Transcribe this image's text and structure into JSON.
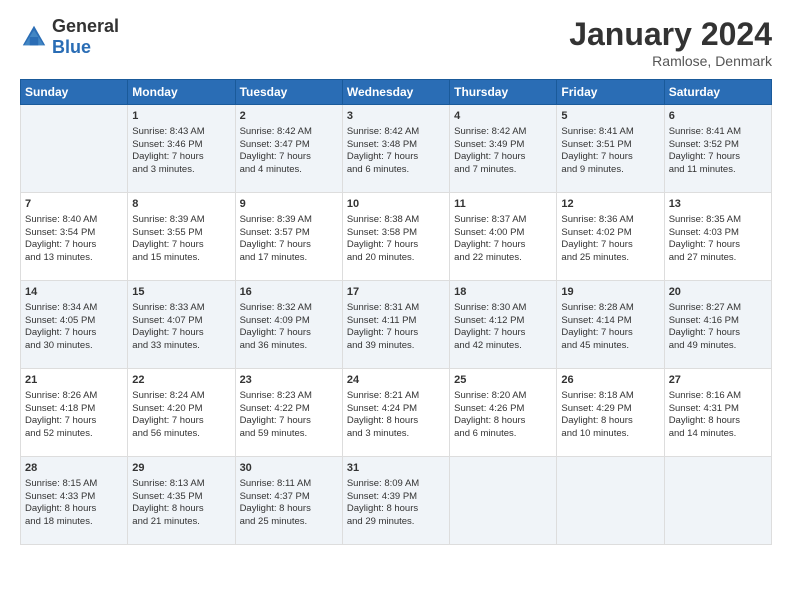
{
  "logo": {
    "general": "General",
    "blue": "Blue"
  },
  "header": {
    "month": "January 2024",
    "location": "Ramlose, Denmark"
  },
  "weekdays": [
    "Sunday",
    "Monday",
    "Tuesday",
    "Wednesday",
    "Thursday",
    "Friday",
    "Saturday"
  ],
  "rows": [
    [
      {
        "day": "",
        "lines": []
      },
      {
        "day": "1",
        "lines": [
          "Sunrise: 8:43 AM",
          "Sunset: 3:46 PM",
          "Daylight: 7 hours",
          "and 3 minutes."
        ]
      },
      {
        "day": "2",
        "lines": [
          "Sunrise: 8:42 AM",
          "Sunset: 3:47 PM",
          "Daylight: 7 hours",
          "and 4 minutes."
        ]
      },
      {
        "day": "3",
        "lines": [
          "Sunrise: 8:42 AM",
          "Sunset: 3:48 PM",
          "Daylight: 7 hours",
          "and 6 minutes."
        ]
      },
      {
        "day": "4",
        "lines": [
          "Sunrise: 8:42 AM",
          "Sunset: 3:49 PM",
          "Daylight: 7 hours",
          "and 7 minutes."
        ]
      },
      {
        "day": "5",
        "lines": [
          "Sunrise: 8:41 AM",
          "Sunset: 3:51 PM",
          "Daylight: 7 hours",
          "and 9 minutes."
        ]
      },
      {
        "day": "6",
        "lines": [
          "Sunrise: 8:41 AM",
          "Sunset: 3:52 PM",
          "Daylight: 7 hours",
          "and 11 minutes."
        ]
      }
    ],
    [
      {
        "day": "7",
        "lines": [
          "Sunrise: 8:40 AM",
          "Sunset: 3:54 PM",
          "Daylight: 7 hours",
          "and 13 minutes."
        ]
      },
      {
        "day": "8",
        "lines": [
          "Sunrise: 8:39 AM",
          "Sunset: 3:55 PM",
          "Daylight: 7 hours",
          "and 15 minutes."
        ]
      },
      {
        "day": "9",
        "lines": [
          "Sunrise: 8:39 AM",
          "Sunset: 3:57 PM",
          "Daylight: 7 hours",
          "and 17 minutes."
        ]
      },
      {
        "day": "10",
        "lines": [
          "Sunrise: 8:38 AM",
          "Sunset: 3:58 PM",
          "Daylight: 7 hours",
          "and 20 minutes."
        ]
      },
      {
        "day": "11",
        "lines": [
          "Sunrise: 8:37 AM",
          "Sunset: 4:00 PM",
          "Daylight: 7 hours",
          "and 22 minutes."
        ]
      },
      {
        "day": "12",
        "lines": [
          "Sunrise: 8:36 AM",
          "Sunset: 4:02 PM",
          "Daylight: 7 hours",
          "and 25 minutes."
        ]
      },
      {
        "day": "13",
        "lines": [
          "Sunrise: 8:35 AM",
          "Sunset: 4:03 PM",
          "Daylight: 7 hours",
          "and 27 minutes."
        ]
      }
    ],
    [
      {
        "day": "14",
        "lines": [
          "Sunrise: 8:34 AM",
          "Sunset: 4:05 PM",
          "Daylight: 7 hours",
          "and 30 minutes."
        ]
      },
      {
        "day": "15",
        "lines": [
          "Sunrise: 8:33 AM",
          "Sunset: 4:07 PM",
          "Daylight: 7 hours",
          "and 33 minutes."
        ]
      },
      {
        "day": "16",
        "lines": [
          "Sunrise: 8:32 AM",
          "Sunset: 4:09 PM",
          "Daylight: 7 hours",
          "and 36 minutes."
        ]
      },
      {
        "day": "17",
        "lines": [
          "Sunrise: 8:31 AM",
          "Sunset: 4:11 PM",
          "Daylight: 7 hours",
          "and 39 minutes."
        ]
      },
      {
        "day": "18",
        "lines": [
          "Sunrise: 8:30 AM",
          "Sunset: 4:12 PM",
          "Daylight: 7 hours",
          "and 42 minutes."
        ]
      },
      {
        "day": "19",
        "lines": [
          "Sunrise: 8:28 AM",
          "Sunset: 4:14 PM",
          "Daylight: 7 hours",
          "and 45 minutes."
        ]
      },
      {
        "day": "20",
        "lines": [
          "Sunrise: 8:27 AM",
          "Sunset: 4:16 PM",
          "Daylight: 7 hours",
          "and 49 minutes."
        ]
      }
    ],
    [
      {
        "day": "21",
        "lines": [
          "Sunrise: 8:26 AM",
          "Sunset: 4:18 PM",
          "Daylight: 7 hours",
          "and 52 minutes."
        ]
      },
      {
        "day": "22",
        "lines": [
          "Sunrise: 8:24 AM",
          "Sunset: 4:20 PM",
          "Daylight: 7 hours",
          "and 56 minutes."
        ]
      },
      {
        "day": "23",
        "lines": [
          "Sunrise: 8:23 AM",
          "Sunset: 4:22 PM",
          "Daylight: 7 hours",
          "and 59 minutes."
        ]
      },
      {
        "day": "24",
        "lines": [
          "Sunrise: 8:21 AM",
          "Sunset: 4:24 PM",
          "Daylight: 8 hours",
          "and 3 minutes."
        ]
      },
      {
        "day": "25",
        "lines": [
          "Sunrise: 8:20 AM",
          "Sunset: 4:26 PM",
          "Daylight: 8 hours",
          "and 6 minutes."
        ]
      },
      {
        "day": "26",
        "lines": [
          "Sunrise: 8:18 AM",
          "Sunset: 4:29 PM",
          "Daylight: 8 hours",
          "and 10 minutes."
        ]
      },
      {
        "day": "27",
        "lines": [
          "Sunrise: 8:16 AM",
          "Sunset: 4:31 PM",
          "Daylight: 8 hours",
          "and 14 minutes."
        ]
      }
    ],
    [
      {
        "day": "28",
        "lines": [
          "Sunrise: 8:15 AM",
          "Sunset: 4:33 PM",
          "Daylight: 8 hours",
          "and 18 minutes."
        ]
      },
      {
        "day": "29",
        "lines": [
          "Sunrise: 8:13 AM",
          "Sunset: 4:35 PM",
          "Daylight: 8 hours",
          "and 21 minutes."
        ]
      },
      {
        "day": "30",
        "lines": [
          "Sunrise: 8:11 AM",
          "Sunset: 4:37 PM",
          "Daylight: 8 hours",
          "and 25 minutes."
        ]
      },
      {
        "day": "31",
        "lines": [
          "Sunrise: 8:09 AM",
          "Sunset: 4:39 PM",
          "Daylight: 8 hours",
          "and 29 minutes."
        ]
      },
      {
        "day": "",
        "lines": []
      },
      {
        "day": "",
        "lines": []
      },
      {
        "day": "",
        "lines": []
      }
    ]
  ]
}
